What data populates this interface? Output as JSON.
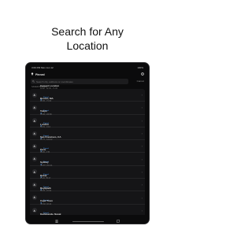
{
  "headline": {
    "line1": "Search for Any",
    "line2": "Location"
  },
  "status_bar": {
    "time": "3:09 PM",
    "date": "Mon Jun 12",
    "battery": "100%"
  },
  "app_header": {
    "title": "Pinned",
    "edit_label": "Edit"
  },
  "search": {
    "placeholder": "Search city, address or coordinates",
    "cancel_label": "Cancel"
  },
  "section_label": "SAVED PLACES",
  "rows": [
    {
      "title": "Current Location",
      "subtitle": "Local · 42.36, -71.06",
      "tag": "Pinned"
    },
    {
      "title": "Boston, MA",
      "subtitle": "42.36, -71.06",
      "tag": "Pinned"
    },
    {
      "title": "Tokyo",
      "subtitle": "35.68, 139.69",
      "tag": "Pinned"
    },
    {
      "title": "London",
      "subtitle": "51.51, -0.13",
      "tag": "Pinned"
    },
    {
      "title": "San Francisco, CA",
      "subtitle": "37.77, -122.42",
      "tag": "Pinned"
    },
    {
      "title": "Paris",
      "subtitle": "48.86, 2.35",
      "tag": "Pinned"
    },
    {
      "title": "Sydney",
      "subtitle": "-33.87, 151.21",
      "tag": "Pinned"
    },
    {
      "title": "Dubai",
      "subtitle": "25.20, 55.27",
      "tag": "Pinned"
    },
    {
      "title": "Reykjavík",
      "subtitle": "64.15, -21.94",
      "tag": "Pinned"
    },
    {
      "title": "Cape Town",
      "subtitle": "-33.92, 18.42",
      "tag": "Pinned"
    },
    {
      "title": "Kathmandu, Nepal",
      "subtitle": "27.72, 85.32",
      "tag": "Pinned"
    }
  ],
  "tabbar": {
    "tabs": [
      {
        "icon": "list-icon"
      },
      {
        "icon": "map-icon"
      }
    ]
  },
  "colors": {
    "background": "#ffffff",
    "device": "#0b0b0c",
    "accent": "#4a9fff"
  }
}
